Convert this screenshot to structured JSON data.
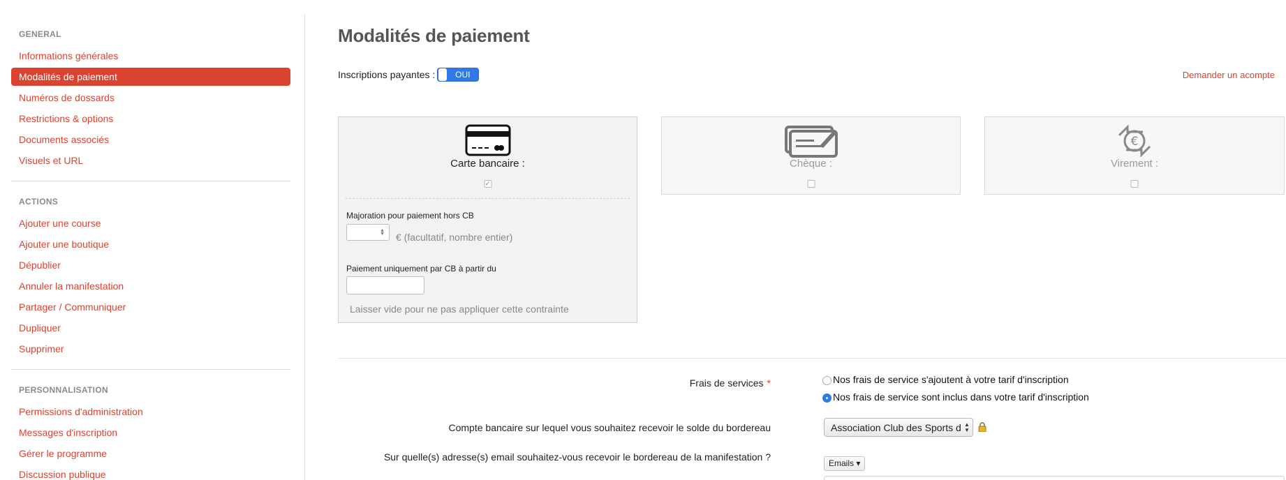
{
  "sidebar": {
    "sections": [
      {
        "heading": "GENERAL",
        "items": [
          {
            "label": "Informations générales",
            "active": false
          },
          {
            "label": "Modalités de paiement",
            "active": true
          },
          {
            "label": "Numéros de dossards",
            "active": false
          },
          {
            "label": "Restrictions & options",
            "active": false
          },
          {
            "label": "Documents associés",
            "active": false
          },
          {
            "label": "Visuels et URL",
            "active": false
          }
        ]
      },
      {
        "heading": "ACTIONS",
        "items": [
          {
            "label": "Ajouter une course"
          },
          {
            "label": "Ajouter une boutique"
          },
          {
            "label": "Dépublier"
          },
          {
            "label": "Annuler la manifestation"
          },
          {
            "label": "Partager / Communiquer"
          },
          {
            "label": "Dupliquer"
          },
          {
            "label": "Supprimer"
          }
        ]
      },
      {
        "heading": "PERSONNALISATION",
        "items": [
          {
            "label": "Permissions d'administration"
          },
          {
            "label": "Messages d'inscription"
          },
          {
            "label": "Gérer le programme"
          },
          {
            "label": "Discussion publique"
          }
        ]
      }
    ]
  },
  "main": {
    "title": "Modalités de paiement",
    "inscriptions_label": "Inscriptions payantes :",
    "toggle_label": "OUI",
    "acompte_link": "Demander un acompte",
    "payment_methods": [
      {
        "label": "Carte bancaire :",
        "icon": "credit-card-icon",
        "checked": true
      },
      {
        "label": "Chèque :",
        "icon": "cheque-icon",
        "checked": false
      },
      {
        "label": "Virement :",
        "icon": "euro-transfer-icon",
        "checked": false
      }
    ],
    "cb_options": {
      "majoration_label": "Majoration pour paiement hors CB",
      "majoration_value": "",
      "majoration_suffix": "€ (facultatif, nombre entier)",
      "cb_only_label": "Paiement uniquement par CB à partir du",
      "cb_only_value": "",
      "hint": "Laisser vide pour ne pas appliquer cette contrainte"
    },
    "frais": {
      "label": "Frais de services",
      "required_mark": "*",
      "options": [
        {
          "label": "Nos frais de service s'ajoutent à votre tarif d'inscription",
          "selected": false
        },
        {
          "label": "Nos frais de service sont inclus dans votre tarif d'inscription",
          "selected": true
        }
      ]
    },
    "compte": {
      "label": "Compte bancaire sur lequel vous souhaitez recevoir le solde du bordereau",
      "selected": "Association Club des Sports d"
    },
    "emails": {
      "label": "Sur quelle(s) adresse(s) email souhaitez-vous recevoir le bordereau de la manifestation ?",
      "button": "Emails"
    }
  },
  "colors": {
    "accent": "#d9432f",
    "toggle_blue": "#2f7ae5"
  }
}
